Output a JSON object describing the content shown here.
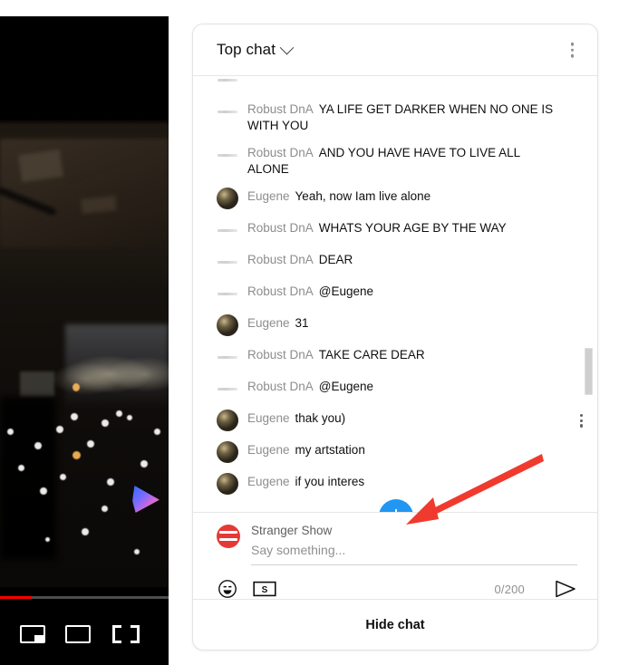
{
  "player": {
    "progress_percent": 19,
    "controls": [
      {
        "name": "miniplayer",
        "label": "Miniplayer"
      },
      {
        "name": "theater",
        "label": "Theater mode"
      },
      {
        "name": "fullscreen",
        "label": "Full screen"
      }
    ],
    "watermark": "play-triangle-watermark"
  },
  "chat": {
    "header": {
      "mode_label": "Top chat",
      "chevron_icon": "chevron-down-icon",
      "menu_icon": "more-vertical-icon"
    },
    "messages": [
      {
        "author": "",
        "text": "",
        "avatar": "ghost",
        "partial": true
      },
      {
        "author": "Robust DnA",
        "text": "YA LIFE GET DARKER WHEN NO ONE IS WITH YOU",
        "avatar": "ghost"
      },
      {
        "author": "Robust DnA",
        "text": "AND YOU HAVE HAVE TO LIVE ALL ALONE",
        "avatar": "ghost"
      },
      {
        "author": "Eugene",
        "text": "Yeah, now Iam live alone",
        "avatar": "photo"
      },
      {
        "author": "Robust DnA",
        "text": "WHATS YOUR AGE BY THE WAY",
        "avatar": "ghost"
      },
      {
        "author": "Robust DnA",
        "text": "DEAR",
        "avatar": "ghost"
      },
      {
        "author": "Robust DnA",
        "text": "@Eugene",
        "avatar": "ghost"
      },
      {
        "author": "Eugene",
        "text": "31",
        "avatar": "photo"
      },
      {
        "author": "Robust DnA",
        "text": "TAKE CARE DEAR",
        "avatar": "ghost"
      },
      {
        "author": "Robust DnA",
        "text": "@Eugene",
        "avatar": "ghost"
      },
      {
        "author": "Eugene",
        "text": "thak you)",
        "avatar": "photo",
        "kebab": true
      },
      {
        "author": "Eugene",
        "text": "my artstation",
        "avatar": "photo"
      },
      {
        "author": "Eugene",
        "text": "if you interes",
        "avatar": "photo"
      }
    ],
    "scroll_to_bottom_icon": "arrow-down-circle-icon",
    "scrollbar": "vertical-scrollbar"
  },
  "input": {
    "channel_name": "Stranger Show",
    "avatar_icon": "blocked-avatar-icon",
    "placeholder": "Say something...",
    "value": "",
    "emoji_icon": "emoji-smiley-icon",
    "superchat_icon": "dollar-bill-icon",
    "counter": "0/200",
    "send_icon": "send-arrow-icon"
  },
  "footer": {
    "hide_chat_label": "Hide chat"
  },
  "annotation": {
    "arrow": "red-pointer-arrow",
    "color": "#f03a2e"
  }
}
